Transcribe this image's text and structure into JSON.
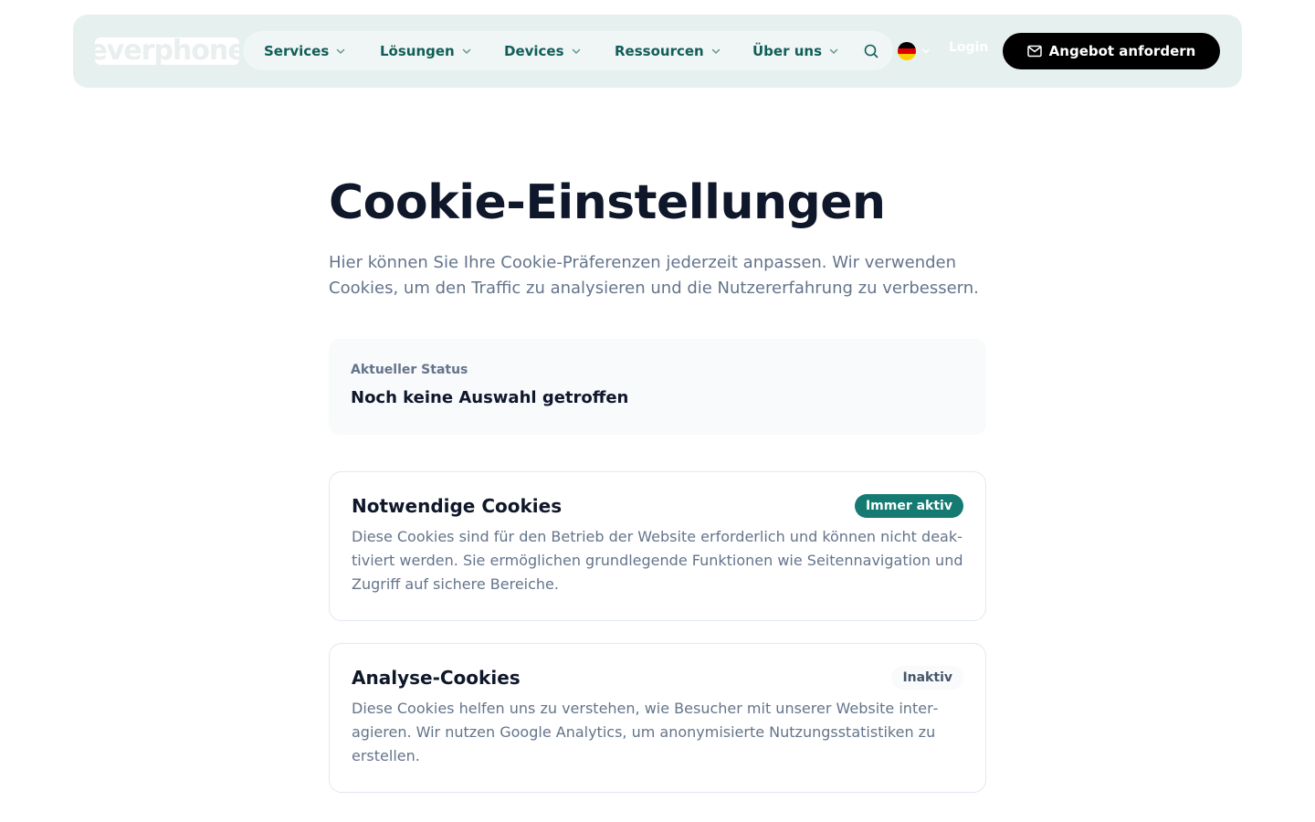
{
  "header": {
    "logo_text": "everphone",
    "nav": [
      {
        "label": "Services"
      },
      {
        "label": "Lösungen"
      },
      {
        "label": "Devices"
      },
      {
        "label": "Ressourcen"
      },
      {
        "label": "Über uns"
      }
    ],
    "search_icon": "search-icon",
    "language_flag": "germany-flag-icon",
    "login_label": "Login",
    "cta_label": "Angebot anfordern",
    "cta_icon": "mail-icon"
  },
  "main": {
    "title": "Cookie-Einstellungen",
    "intro": "Hier können Sie Ihre Cookie-Präferenzen jederzeit anpassen. Wir verwenden Cookies, um den Traffic zu analysieren und die Nutzererfahrung zu verbessern.",
    "status": {
      "label": "Aktueller Status",
      "value": "Noch keine Auswahl getroffen"
    },
    "cards": [
      {
        "title": "Notwendige Cookies",
        "badge": "Immer aktiv",
        "text": "Diese Cookies sind für den Betrieb der Website erforderlich und können nicht deak­tiviert werden. Sie ermöglichen grundlegende Funktionen wie Seitennavigation und Zugriff auf sichere Bereiche."
      },
      {
        "title": "Analyse-Cookies",
        "badge": "Inaktiv",
        "text": "Diese Cookies helfen uns zu verstehen, wie Besucher mit unserer Website inter­agieren. Wir nutzen Google Analytics, um anonymisierte Nutzungsstatistiken zu erstellen."
      }
    ]
  },
  "colors": {
    "accent": "#115e59",
    "badge_active": "#147a72",
    "navbar_bg": "#e6f0ef",
    "cta_bg": "#000000"
  }
}
